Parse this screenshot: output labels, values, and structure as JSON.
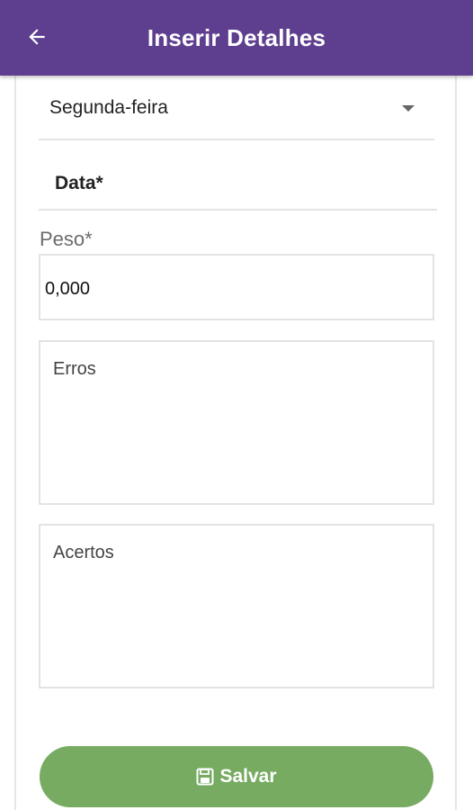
{
  "app_bar": {
    "title": "Inserir Detalhes",
    "back_icon": "arrow-left-icon",
    "background_color": "#5e3f8f"
  },
  "form": {
    "weekday": {
      "selected": "Segunda-feira"
    },
    "date": {
      "label": "Data*"
    },
    "weight": {
      "label": "Peso*",
      "value": "0,000"
    },
    "errors": {
      "placeholder": "Erros"
    },
    "successes": {
      "placeholder": "Acertos"
    }
  },
  "save_button": {
    "label": "Salvar",
    "icon": "floppy-disk-icon",
    "color": "#77ab62"
  }
}
